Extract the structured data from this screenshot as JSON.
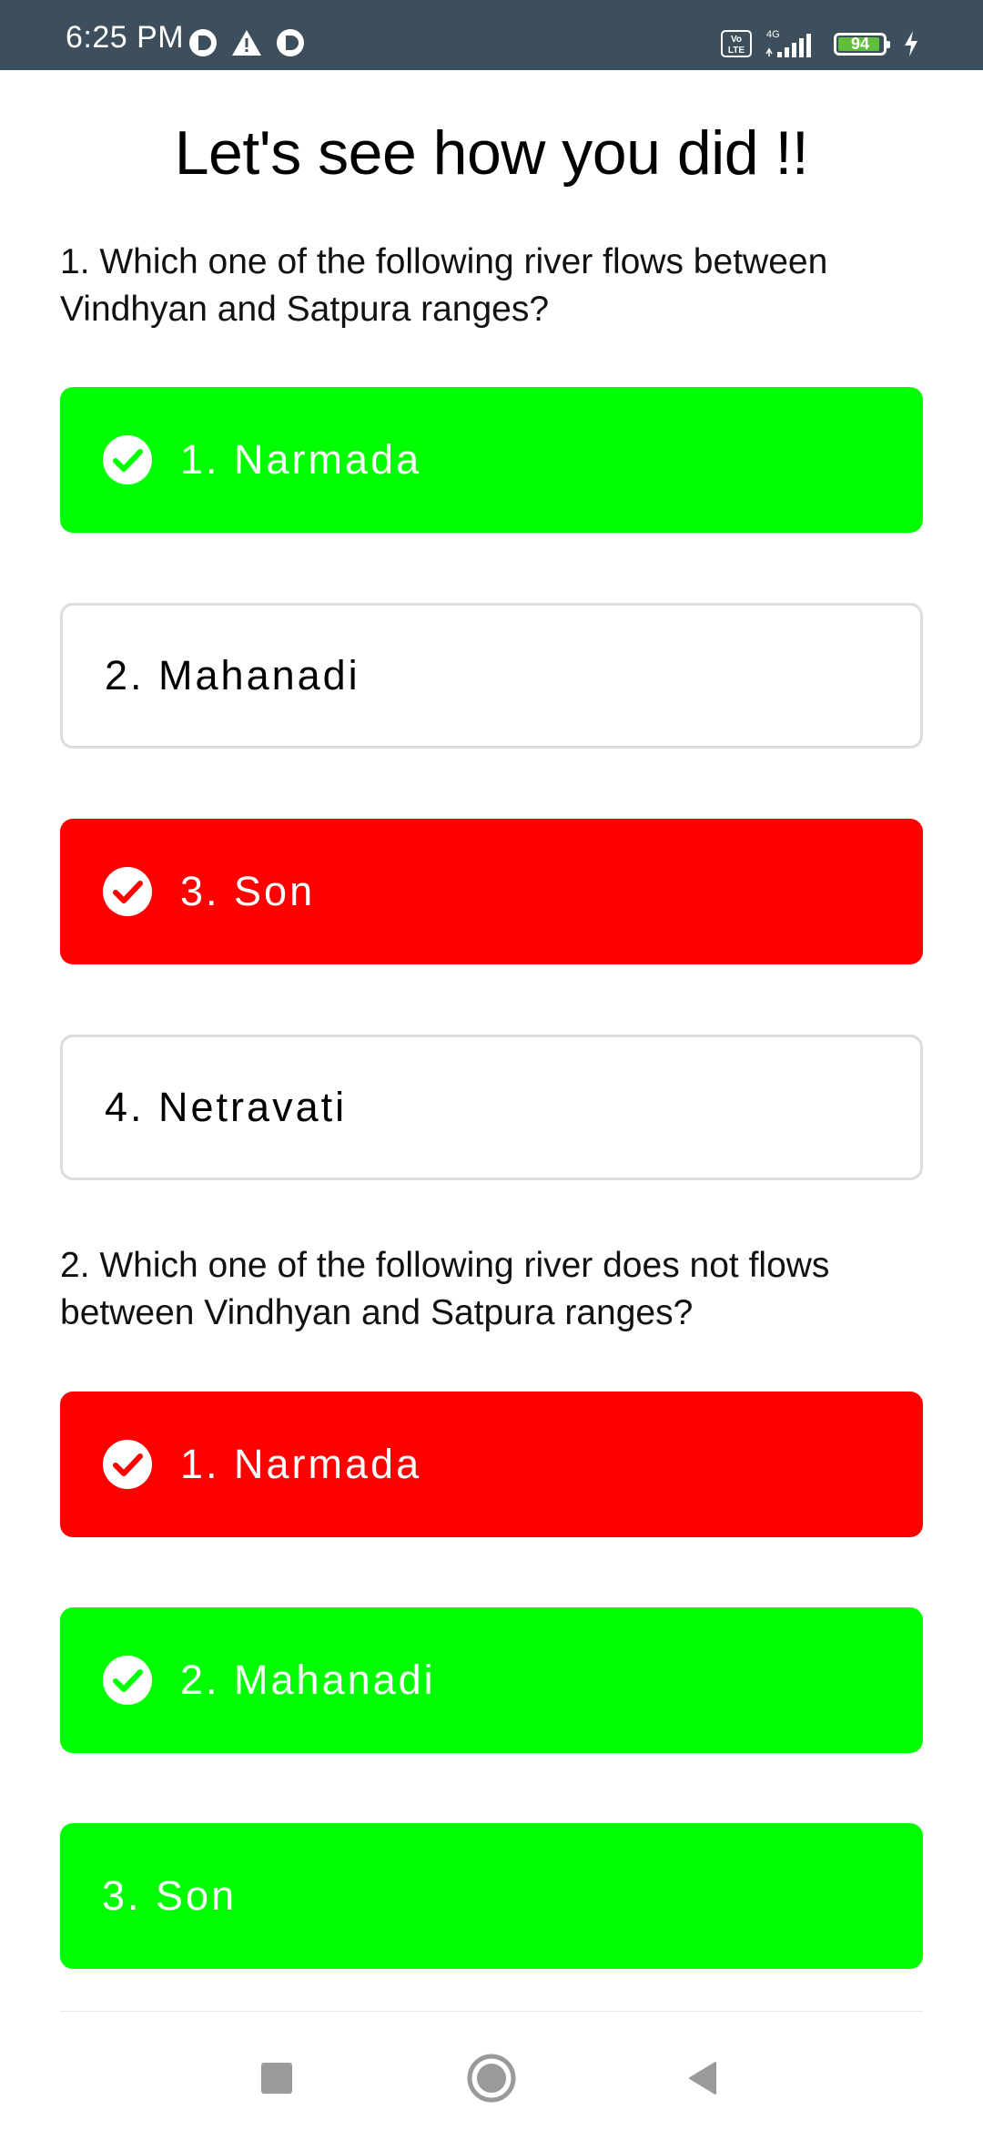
{
  "status_bar": {
    "time": "6:25 PM",
    "battery_level": "94",
    "battery_fill_fraction": 0.94,
    "network": "4G",
    "volte": "VoLTE",
    "icons": [
      "notification-app-icon",
      "warning-icon",
      "notification-app-icon",
      "volte-icon",
      "signal-icon",
      "battery-icon",
      "charging-icon"
    ]
  },
  "page": {
    "title": "Let's see how you did !!"
  },
  "colors": {
    "correct": "#00ff00",
    "wrong": "#ff0000",
    "neutral_border": "#dddddd",
    "status_bar": "#3d4f5c"
  },
  "questions": [
    {
      "text": "1. Which one of the following river flows between Vindhyan and Satpura ranges?",
      "options": [
        {
          "label": "1. Narmada",
          "state": "correct",
          "checked": true
        },
        {
          "label": "2. Mahanadi",
          "state": "neutral",
          "checked": false
        },
        {
          "label": "3. Son",
          "state": "wrong",
          "checked": true
        },
        {
          "label": "4. Netravati",
          "state": "neutral",
          "checked": false
        }
      ]
    },
    {
      "text": "2. Which one of the following river does not flows between Vindhyan and Satpura ranges?",
      "options": [
        {
          "label": "1. Narmada",
          "state": "wrong",
          "checked": true
        },
        {
          "label": "2. Mahanadi",
          "state": "correct",
          "checked": true
        },
        {
          "label": "3. Son",
          "state": "correct",
          "checked": false
        }
      ]
    }
  ],
  "nav_bar": {
    "buttons": [
      "recents-square-icon",
      "home-circle-icon",
      "back-triangle-icon"
    ]
  }
}
